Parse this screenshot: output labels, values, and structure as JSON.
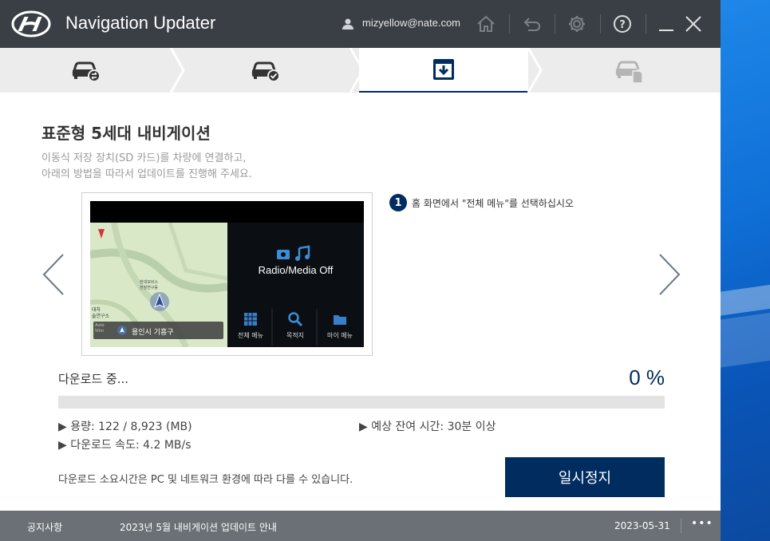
{
  "window": {
    "title": "Navigation Updater",
    "user_email": "mizyellow@nate.com"
  },
  "steps": [
    {
      "name": "car-connect",
      "state": "done"
    },
    {
      "name": "car-check",
      "state": "done"
    },
    {
      "name": "download",
      "state": "active"
    },
    {
      "name": "car-install",
      "state": "pending"
    }
  ],
  "content": {
    "heading": "표준형 5세대 내비게이션",
    "desc_line1": "이동식 저장 장치(SD 카드)를 차량에 연결하고,",
    "desc_line2": "아래의 방법을 따라서 업데이트를 진행해 주세요.",
    "instruction_number": "1",
    "instruction_text": "홈 화면에서 \"전체 메뉴\"를 선택하십시오"
  },
  "nav_screen": {
    "radio_text": "Radio/Media Off",
    "menu_all": "전체 메뉴",
    "menu_destination": "목적지",
    "menu_my": "마이 메뉴",
    "map_location": "용인시 기흥구",
    "map_label_1": "현대모비스",
    "map_label_2": "전장연구동",
    "map_label_3": "대차",
    "map_label_4": "술연구소",
    "map_auto": "Auto",
    "map_scale": "50m"
  },
  "download": {
    "label": "다운로드 중...",
    "percent_text": "0 %",
    "progress": 0,
    "capacity": "▶ 용량: 122 / 8,923 (MB)",
    "remaining": "▶ 예상 잔여 시간: 30분 이상",
    "speed": "▶ 다운로드 속도: 4.2 MB/s",
    "notice": "다운로드 소요시간은 PC 및 네트워크 환경에 따라 다를 수 있습니다.",
    "pause_label": "일시정지"
  },
  "footer": {
    "label": "공지사항",
    "title": "2023년 5월 내비게이션 업데이트 안내",
    "date": "2023-05-31",
    "more": "•••"
  },
  "colors": {
    "brand": "#002c5f",
    "titlebar": "#3a3f45",
    "footer": "#6b7076"
  }
}
